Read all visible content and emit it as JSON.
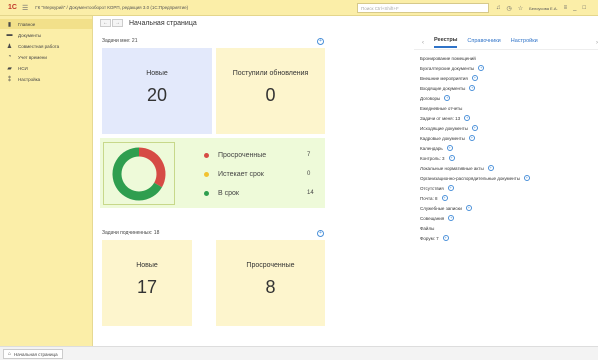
{
  "titlebar": {
    "logo": "1С",
    "app_title": "ГК \"Меркурий\" / Документооборот КОРП, редакция 3.0 (1С:Предприятие)",
    "search_placeholder": "Поиск Ctrl+Shift+F",
    "user": "Белоусова Е.А."
  },
  "sidebar": {
    "items": [
      {
        "label": "Главное",
        "icon": "home-icon"
      },
      {
        "label": "Документы",
        "icon": "folder-icon"
      },
      {
        "label": "Совместная работа",
        "icon": "people-icon"
      },
      {
        "label": "Учет времени",
        "icon": "clock-icon"
      },
      {
        "label": "НСИ",
        "icon": "book-icon"
      },
      {
        "label": "Настройка",
        "icon": "settings-icon"
      }
    ]
  },
  "nav": {
    "back": "←",
    "forward": "→",
    "page_title": "Начальная страница"
  },
  "tasks_mine": {
    "label": "Задачи мне: 21",
    "new_label": "Новые",
    "new_value": "20",
    "updates_label": "Поступили обновления",
    "updates_value": "0"
  },
  "chart_data": {
    "type": "pie",
    "style": "donut",
    "categories": [
      "Просроченные",
      "Истекает срок",
      "В срок"
    ],
    "values": [
      7,
      0,
      14
    ],
    "colors": [
      "#d64b45",
      "#f2c230",
      "#2f9e4f"
    ],
    "labels": [
      "7",
      "0",
      "14"
    ]
  },
  "tasks_sub": {
    "label": "Задачи подчиненных: 18",
    "new_label": "Новые",
    "new_value": "17",
    "overdue_label": "Просроченные",
    "overdue_value": "8"
  },
  "right_panel": {
    "tabs": [
      "Реестры",
      "Справочники",
      "Настройки"
    ],
    "items": [
      {
        "label": "Бронирование помещений",
        "plus": false
      },
      {
        "label": "Бухгалтерские документы",
        "plus": true
      },
      {
        "label": "Внешние мероприятия",
        "plus": true
      },
      {
        "label": "Входящие документы",
        "plus": true
      },
      {
        "label": "Договоры",
        "plus": true
      },
      {
        "label": "Ежедневные отчеты",
        "plus": false
      },
      {
        "label": "Задачи от меня: 13",
        "plus": true
      },
      {
        "label": "Исходящие документы",
        "plus": true
      },
      {
        "label": "Кадровые документы",
        "plus": true
      },
      {
        "label": "Календарь",
        "plus": true
      },
      {
        "label": "Контроль: 3",
        "plus": true
      },
      {
        "label": "Локальные нормативные акты",
        "plus": true
      },
      {
        "label": "Организационно-распорядительные документы",
        "plus": true
      },
      {
        "label": "Отсутствия",
        "plus": true
      },
      {
        "label": "Почта: 8",
        "plus": true
      },
      {
        "label": "Служебные записки",
        "plus": true
      },
      {
        "label": "Совещания",
        "plus": true
      },
      {
        "label": "Файлы",
        "plus": false
      },
      {
        "label": "Форум: 7",
        "plus": true
      }
    ]
  },
  "bottom": {
    "tab_label": "Начальная страница"
  }
}
